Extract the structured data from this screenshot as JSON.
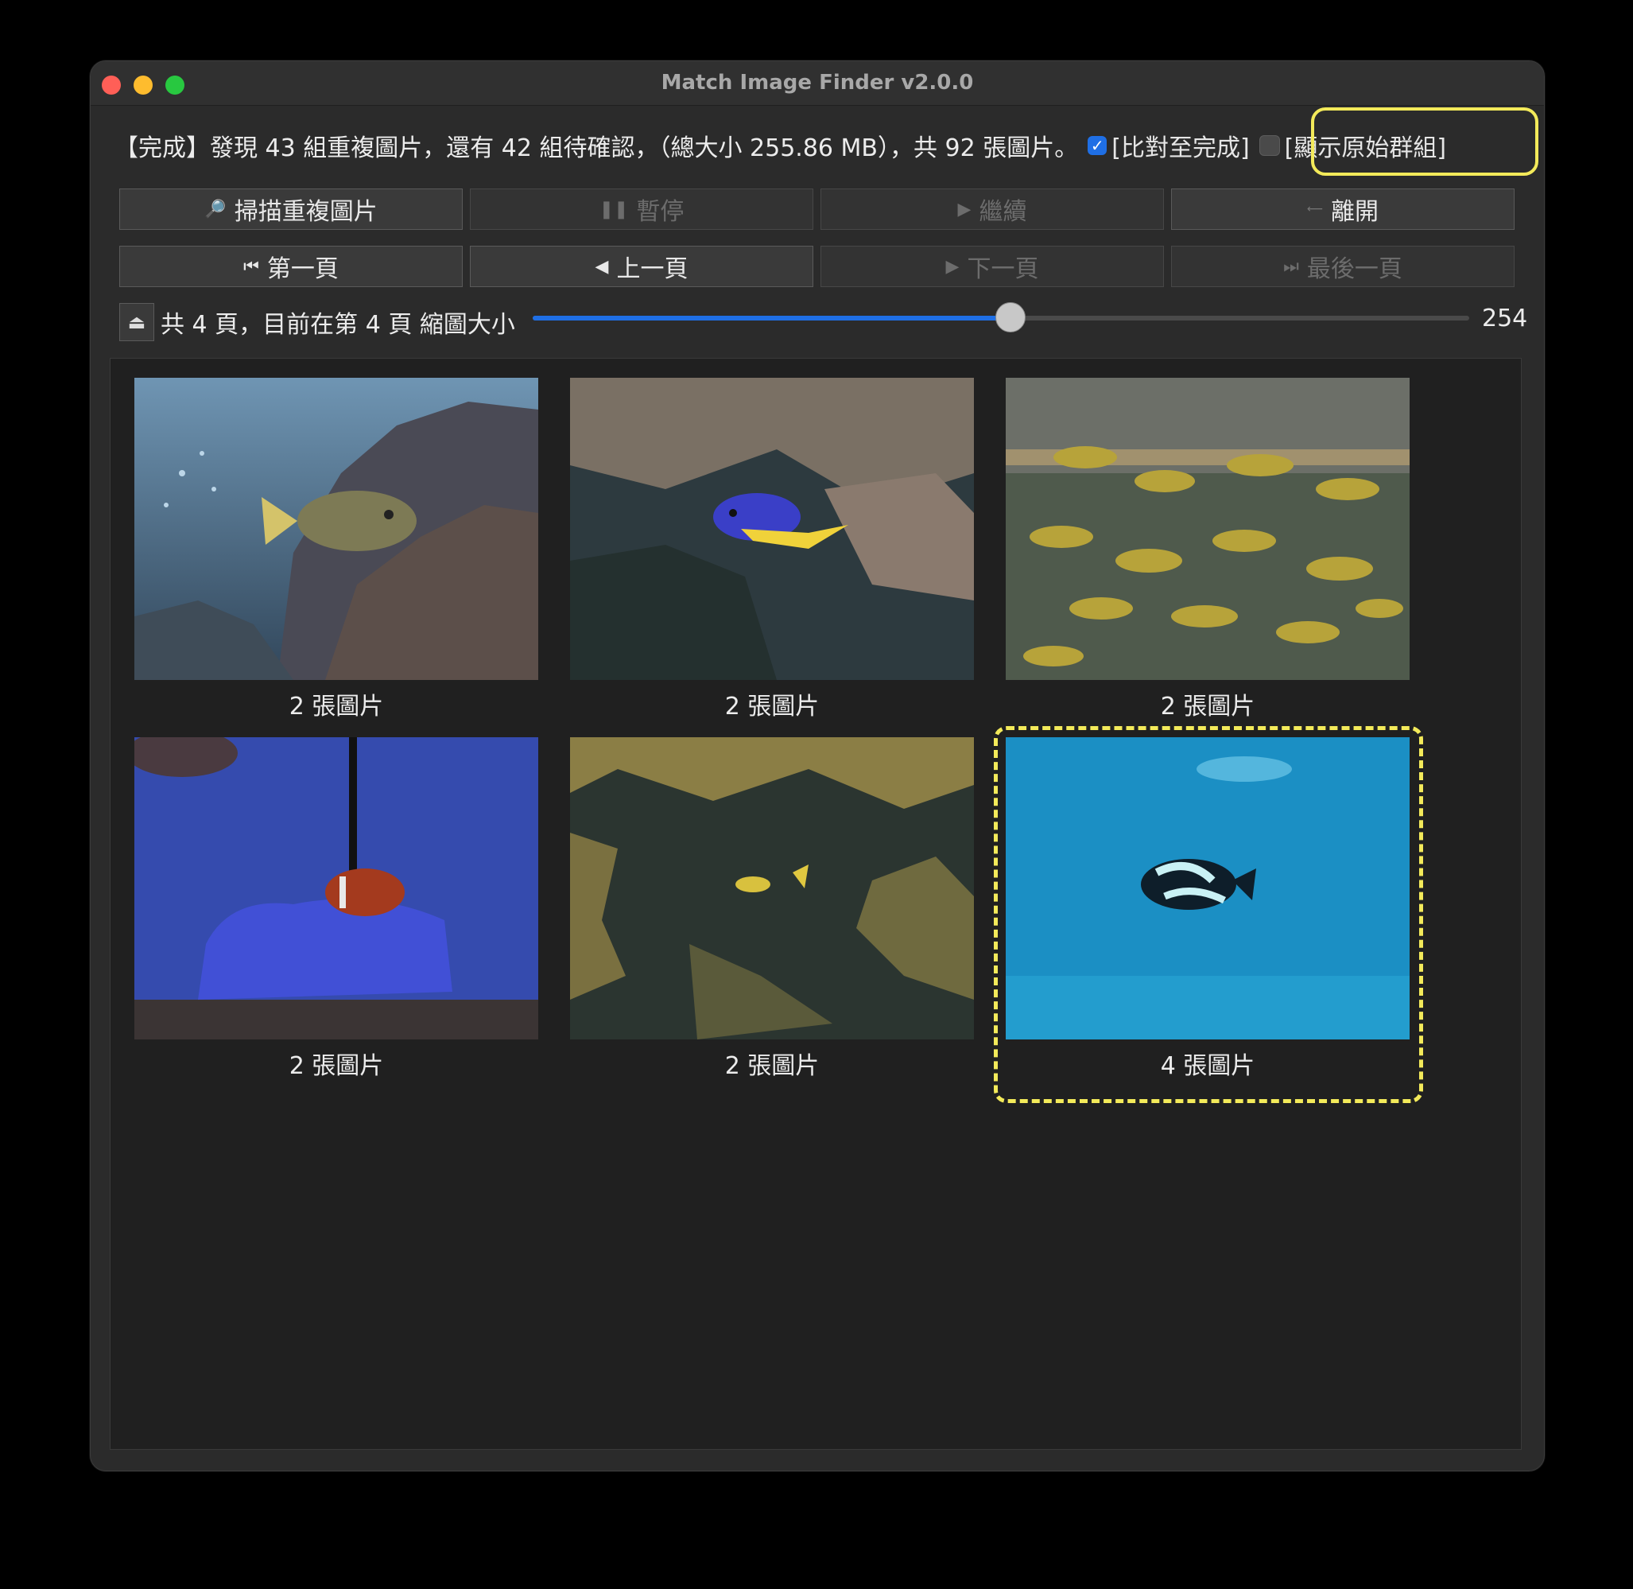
{
  "window": {
    "title": "Match Image Finder v2.0.0"
  },
  "status": {
    "text": "【完成】發現 43 組重複圖片，還有 42 組待確認，（總大小 255.86 MB），共 92 張圖片。",
    "compare_checkbox": {
      "label": "[比對至完成]",
      "checked": true
    },
    "original_group_checkbox": {
      "label": "[顯示原始群組]",
      "checked": false
    }
  },
  "toolbar": {
    "scan": {
      "label": "掃描重複圖片",
      "icon": "magnifier-icon",
      "enabled": true
    },
    "pause": {
      "label": "暫停",
      "icon": "pause-icon",
      "enabled": false
    },
    "continue": {
      "label": "繼續",
      "icon": "play-icon",
      "enabled": false
    },
    "exit": {
      "label": "離開",
      "icon": "end-icon",
      "enabled": true
    }
  },
  "pager": {
    "first": {
      "label": "第一頁",
      "icon": "skip-back-icon",
      "enabled": true
    },
    "prev": {
      "label": "上一頁",
      "icon": "triangle-left-icon",
      "enabled": true
    },
    "next": {
      "label": "下一頁",
      "icon": "triangle-right-icon",
      "enabled": false
    },
    "last": {
      "label": "最後一頁",
      "icon": "skip-forward-icon",
      "enabled": false
    }
  },
  "page_info": "共 4 頁，目前在第 4 頁 縮圖大小",
  "thumb_size": {
    "value": "254",
    "fraction": 0.51
  },
  "groups": [
    {
      "caption": "2 張圖片",
      "scene": "triggerfish-reef"
    },
    {
      "caption": "2 張圖片",
      "scene": "blue-damselfish"
    },
    {
      "caption": "2 張圖片",
      "scene": "yellow-striped-school"
    },
    {
      "caption": "2 張圖片",
      "scene": "clownfish-blue-tank"
    },
    {
      "caption": "2 張圖片",
      "scene": "yellow-fish-dark-reef"
    },
    {
      "caption": "4 張圖片",
      "scene": "spotted-fish-blue-water",
      "highlighted": true
    }
  ]
}
